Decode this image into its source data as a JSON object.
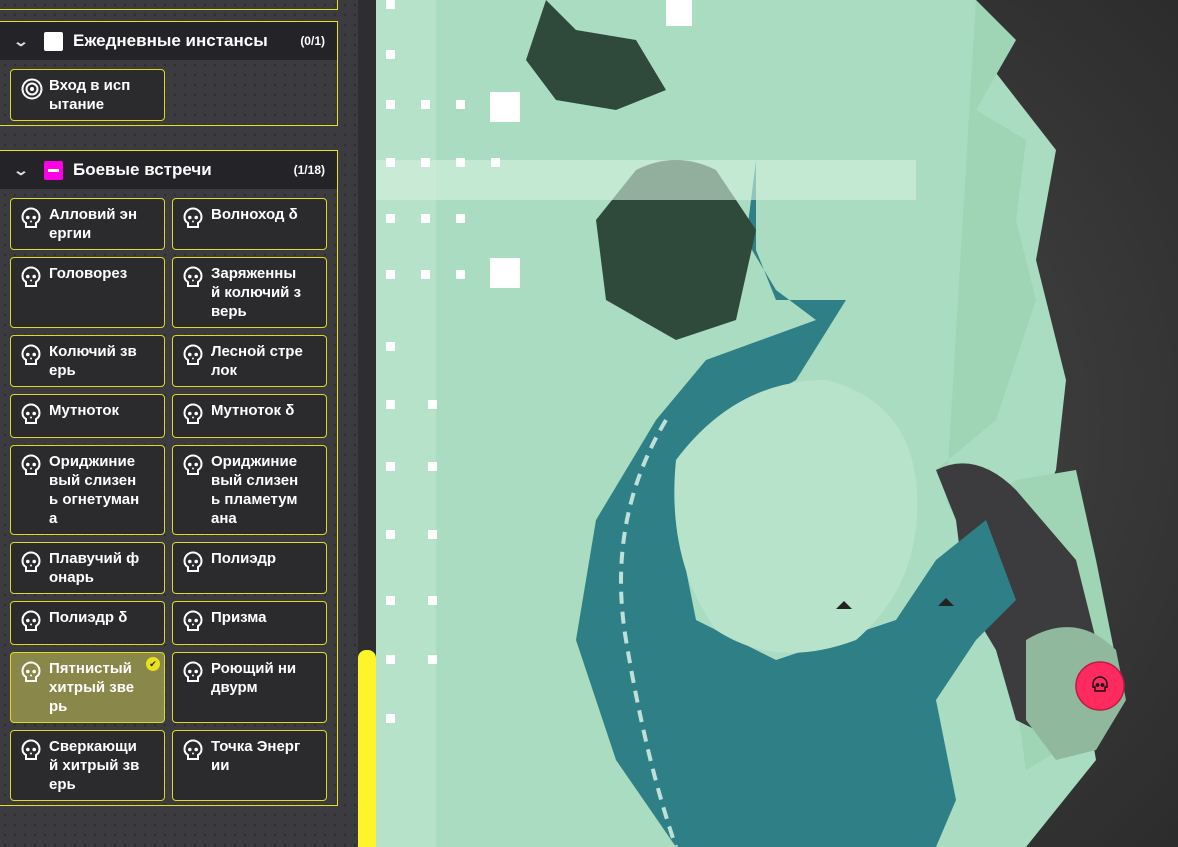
{
  "sections": [
    {
      "title": "Ежедневные инстансы",
      "count": "(0/1)",
      "color": "#ffffff",
      "items": [
        {
          "label": "Вход в испытание",
          "icon": "target-icon",
          "done": false
        }
      ]
    },
    {
      "title": "Боевые встречи",
      "count": "(1/18)",
      "color": "#ff00e6",
      "items": [
        {
          "label": "Алловий энергии",
          "icon": "skull-icon",
          "done": false
        },
        {
          "label": "Волноход δ",
          "icon": "skull-icon",
          "done": false
        },
        {
          "label": "Головорез",
          "icon": "skull-icon",
          "done": false
        },
        {
          "label": "Заряженный колючий зверь",
          "icon": "skull-icon",
          "done": false
        },
        {
          "label": "Колючий зверь",
          "icon": "skull-icon",
          "done": false
        },
        {
          "label": "Лесной стрелок",
          "icon": "skull-icon",
          "done": false
        },
        {
          "label": "Мутноток",
          "icon": "skull-icon",
          "done": false
        },
        {
          "label": "Мутноток δ",
          "icon": "skull-icon",
          "done": false
        },
        {
          "label": "Ориджиниевый слизень огнетумана",
          "icon": "skull-icon",
          "done": false
        },
        {
          "label": "Ориджиниевый слизень пламетумана",
          "icon": "skull-icon",
          "done": false
        },
        {
          "label": "Плавучий фонарь",
          "icon": "skull-icon",
          "done": false
        },
        {
          "label": "Полиэдр",
          "icon": "skull-icon",
          "done": false
        },
        {
          "label": "Полиэдр δ",
          "icon": "skull-icon",
          "done": false
        },
        {
          "label": "Призма",
          "icon": "skull-icon",
          "done": false
        },
        {
          "label": "Пятнистый хитрый зверь",
          "icon": "skull-icon",
          "done": true
        },
        {
          "label": "Роющий нидвурм",
          "icon": "skull-icon",
          "done": false
        },
        {
          "label": "Сверкающий хитрый зверь",
          "icon": "skull-icon",
          "done": false
        },
        {
          "label": "Точка Энергии",
          "icon": "skull-icon",
          "done": false
        }
      ]
    }
  ],
  "map": {
    "marker_color": "#ff2a5f",
    "marker_icon": "skull-icon"
  }
}
